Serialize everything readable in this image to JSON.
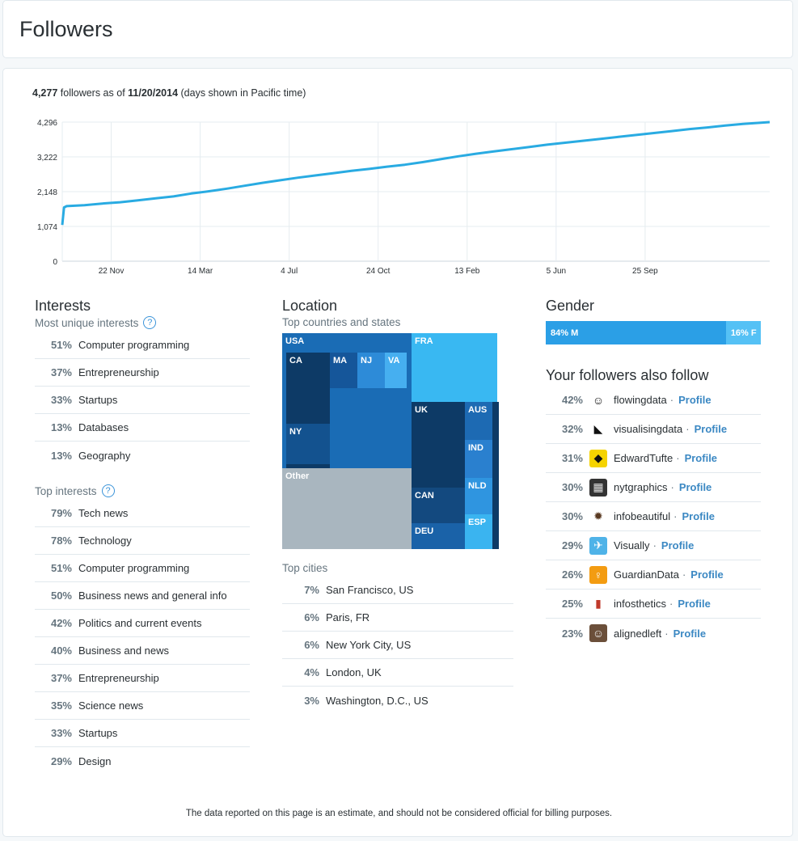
{
  "header": {
    "title": "Followers"
  },
  "summary": {
    "count": "4,277",
    "mid": "followers as of",
    "date": "11/20/2014",
    "note": "(days shown in Pacific time)"
  },
  "chart_data": {
    "type": "line",
    "title": "",
    "xlabel": "",
    "ylabel": "",
    "y_ticks": [
      "0",
      "1,074",
      "2,148",
      "3,222",
      "4,296"
    ],
    "ylim": [
      0,
      4296
    ],
    "x_ticks": [
      "22 Nov",
      "14 Mar",
      "4 Jul",
      "24 Oct",
      "13 Feb",
      "5 Jun",
      "25 Sep"
    ],
    "x_tick_positions": [
      1,
      2,
      3,
      4,
      5,
      6,
      7
    ],
    "xlim": [
      0.45,
      8.4
    ],
    "grid": true,
    "series": [
      {
        "color": "#29abe2",
        "x": [
          0.45,
          0.47,
          0.5,
          0.7,
          0.9,
          1.1,
          1.3,
          1.5,
          1.7,
          1.9,
          2.1,
          2.3,
          2.5,
          2.7,
          2.9,
          3.1,
          3.3,
          3.5,
          3.7,
          3.9,
          4.1,
          4.3,
          4.5,
          4.7,
          4.9,
          5.1,
          5.3,
          5.5,
          5.7,
          5.9,
          6.1,
          6.3,
          6.5,
          6.7,
          6.9,
          7.1,
          7.3,
          7.5,
          7.7,
          7.9,
          8.1,
          8.4
        ],
        "y": [
          1120,
          1660,
          1700,
          1730,
          1780,
          1820,
          1880,
          1940,
          2000,
          2090,
          2160,
          2240,
          2330,
          2420,
          2500,
          2580,
          2650,
          2720,
          2790,
          2850,
          2920,
          2980,
          3060,
          3150,
          3240,
          3320,
          3390,
          3460,
          3530,
          3600,
          3660,
          3720,
          3780,
          3840,
          3900,
          3960,
          4020,
          4080,
          4130,
          4190,
          4240,
          4296
        ]
      }
    ]
  },
  "interests": {
    "title": "Interests",
    "unique_label": "Most unique interests",
    "unique": [
      {
        "pct": "51%",
        "label": "Computer programming"
      },
      {
        "pct": "37%",
        "label": "Entrepreneurship"
      },
      {
        "pct": "33%",
        "label": "Startups"
      },
      {
        "pct": "13%",
        "label": "Databases"
      },
      {
        "pct": "13%",
        "label": "Geography"
      }
    ],
    "top_label": "Top interests",
    "top": [
      {
        "pct": "79%",
        "label": "Tech news"
      },
      {
        "pct": "78%",
        "label": "Technology"
      },
      {
        "pct": "51%",
        "label": "Computer programming"
      },
      {
        "pct": "50%",
        "label": "Business news and general info"
      },
      {
        "pct": "42%",
        "label": "Politics and current events"
      },
      {
        "pct": "40%",
        "label": "Business and news"
      },
      {
        "pct": "37%",
        "label": "Entrepreneurship"
      },
      {
        "pct": "35%",
        "label": "Science news"
      },
      {
        "pct": "33%",
        "label": "Startups"
      },
      {
        "pct": "29%",
        "label": "Design"
      }
    ],
    "help_glyph": "?"
  },
  "location": {
    "title": "Location",
    "countries_label": "Top countries and states",
    "treemap": {
      "usa": "USA",
      "ca": "CA",
      "ma": "MA",
      "nj": "NJ",
      "va": "VA",
      "ny": "NY",
      "fra": "FRA",
      "uk": "UK",
      "aus": "AUS",
      "ind": "IND",
      "nld": "NLD",
      "can": "CAN",
      "esp": "ESP",
      "deu": "DEU",
      "other": "Other"
    },
    "cities_label": "Top cities",
    "cities": [
      {
        "pct": "7%",
        "label": "San Francisco, US"
      },
      {
        "pct": "6%",
        "label": "Paris, FR"
      },
      {
        "pct": "6%",
        "label": "New York City, US"
      },
      {
        "pct": "4%",
        "label": "London, UK"
      },
      {
        "pct": "3%",
        "label": "Washington, D.C., US"
      }
    ]
  },
  "gender": {
    "title": "Gender",
    "male": "84% M",
    "female": "16% F",
    "male_share": 0.84
  },
  "also_follow": {
    "title": "Your followers also follow",
    "link_label": "Profile",
    "separator": "·",
    "accounts": [
      {
        "pct": "42%",
        "name": "flowingdata"
      },
      {
        "pct": "32%",
        "name": "visualisingdata"
      },
      {
        "pct": "31%",
        "name": "EdwardTufte"
      },
      {
        "pct": "30%",
        "name": "nytgraphics"
      },
      {
        "pct": "30%",
        "name": "infobeautiful"
      },
      {
        "pct": "29%",
        "name": "Visually"
      },
      {
        "pct": "26%",
        "name": "GuardianData"
      },
      {
        "pct": "25%",
        "name": "infosthetics"
      },
      {
        "pct": "23%",
        "name": "alignedleft"
      }
    ]
  },
  "footer": {
    "text": "The data reported on this page is an estimate, and should not be considered official for billing purposes."
  }
}
